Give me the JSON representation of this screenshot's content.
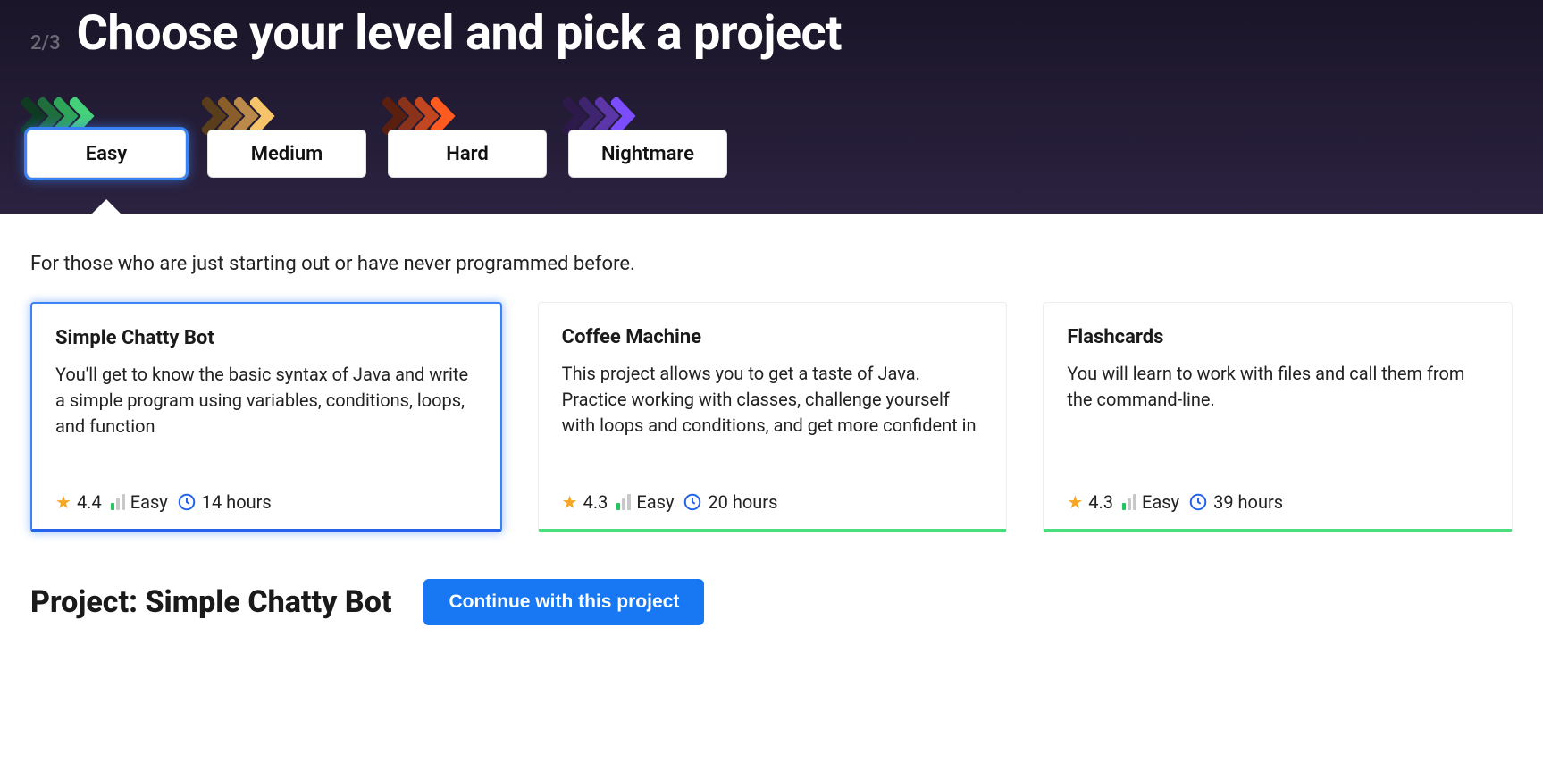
{
  "step": "2/3",
  "title": "Choose your level and pick a project",
  "levels": [
    {
      "label": "Easy",
      "colors": [
        "#0f3b22",
        "#1f6e3c",
        "#2ea559",
        "#45d07a"
      ],
      "selected": true
    },
    {
      "label": "Medium",
      "colors": [
        "#5a3d1a",
        "#8a5e2b",
        "#bb8a4a",
        "#f6c56a"
      ],
      "selected": false
    },
    {
      "label": "Hard",
      "colors": [
        "#5a1f0f",
        "#8a321a",
        "#c24720",
        "#ff5a1f"
      ],
      "selected": false
    },
    {
      "label": "Nightmare",
      "colors": [
        "#2d1a4b",
        "#3f2570",
        "#5c35a8",
        "#7c4dff"
      ],
      "selected": false
    }
  ],
  "level_description": "For those who are just starting out or have never programmed before.",
  "projects": [
    {
      "title": "Simple Chatty Bot",
      "description": "You'll get to know the basic syntax of Java and write a simple program using variables, conditions, loops, and function",
      "rating": "4.4",
      "difficulty": "Easy",
      "hours": "14 hours",
      "selected": true
    },
    {
      "title": "Coffee Machine",
      "description": "This project allows you to get a taste of Java. Practice working with classes, challenge yourself with loops and conditions, and get more confident in",
      "rating": "4.3",
      "difficulty": "Easy",
      "hours": "20 hours",
      "selected": false
    },
    {
      "title": "Flashcards",
      "description": "You will learn to work with files and call them from the command-line.",
      "rating": "4.3",
      "difficulty": "Easy",
      "hours": "39 hours",
      "selected": false
    }
  ],
  "selected_project_heading": "Project: Simple Chatty Bot",
  "continue_label": "Continue with this project"
}
